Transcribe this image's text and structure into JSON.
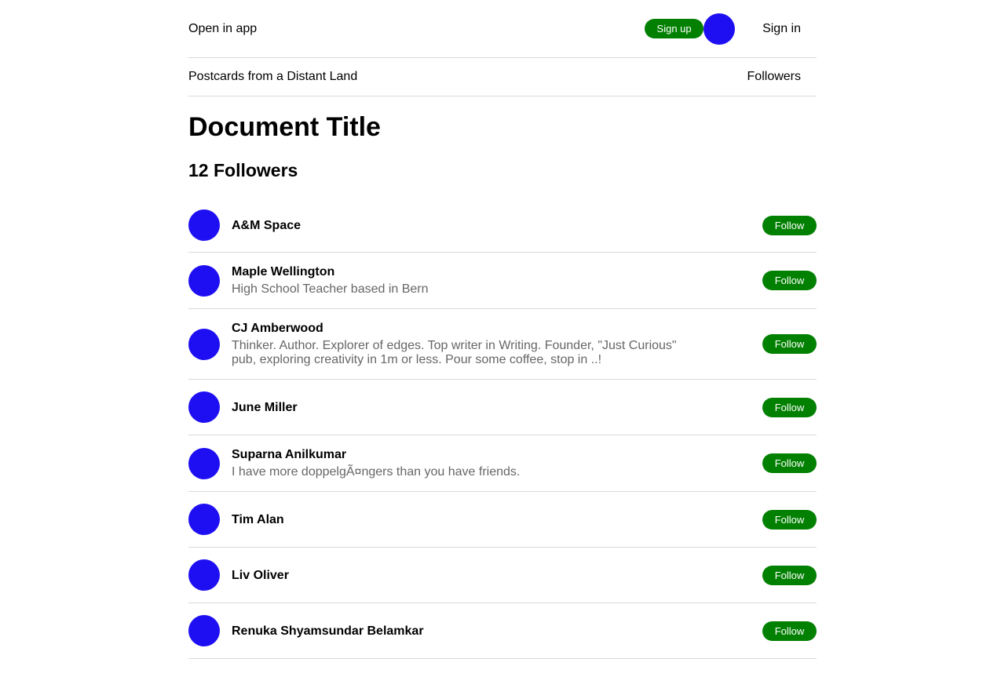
{
  "header": {
    "open_in_app": "Open in app",
    "sign_up_label": "Sign up",
    "sign_in_label": "Sign in"
  },
  "publication": {
    "name": "Postcards from a Distant Land",
    "followers_link": "Followers"
  },
  "main": {
    "title": "Document Title",
    "followers_heading": "12 Followers",
    "follow_label": "Follow",
    "followers": [
      {
        "name": "A&M Space",
        "bio": ""
      },
      {
        "name": "Maple Wellington",
        "bio": "High School Teacher based in Bern"
      },
      {
        "name": "CJ Amberwood",
        "bio": "Thinker. Author. Explorer of edges. Top writer in Writing. Founder, \"Just Curious\" pub, exploring creativity in 1m or less. Pour some coffee, stop in ..!"
      },
      {
        "name": "June Miller",
        "bio": ""
      },
      {
        "name": "Suparna Anilkumar",
        "bio": "I have more doppelgÃ¤ngers than you have friends."
      },
      {
        "name": "Tim Alan",
        "bio": ""
      },
      {
        "name": "Liv Oliver",
        "bio": ""
      },
      {
        "name": "Renuka Shyamsundar Belamkar",
        "bio": ""
      }
    ]
  },
  "colors": {
    "accent_green": "#028002",
    "avatar_blue": "#1e0ff2",
    "divider": "#d9d9d9",
    "bio_gray": "#666666"
  },
  "icons": {
    "avatar": "avatar-placeholder"
  }
}
